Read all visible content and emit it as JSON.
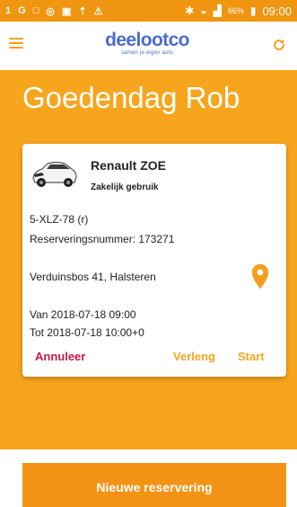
{
  "status_bar": {
    "left_icons": [
      "1",
      "G",
      "□",
      "◎",
      "▣",
      "⇡",
      "⚠"
    ],
    "battery": "66%",
    "time": "09:00"
  },
  "app": {
    "logo": "deelootco",
    "tagline": "samen je eigen auto"
  },
  "greeting": "Goedendag Rob",
  "reservation": {
    "car_model": "Renault ZOE",
    "usage": "Zakelijk gebruik",
    "plate": "5-XLZ-78 (r)",
    "reservation_number_text": "Reserveringsnummer: 173271",
    "address": "Verduinsbos 41, Halsteren",
    "from_text": "Van 2018-07-18 09:00",
    "to_text": "Tot  2018-07-18 10:00+0",
    "actions": {
      "cancel": "Annuleer",
      "extend": "Verleng",
      "start": "Start"
    }
  },
  "new_reservation_label": "Nieuwe reservering",
  "colors": {
    "background": "#f7a51c",
    "accent": "#f59f1d",
    "cancel": "#cc1847",
    "logo": "#4a6ec6"
  },
  "icons": {
    "menu": "menu-icon",
    "refresh": "refresh-icon",
    "location": "location-pin-icon"
  }
}
